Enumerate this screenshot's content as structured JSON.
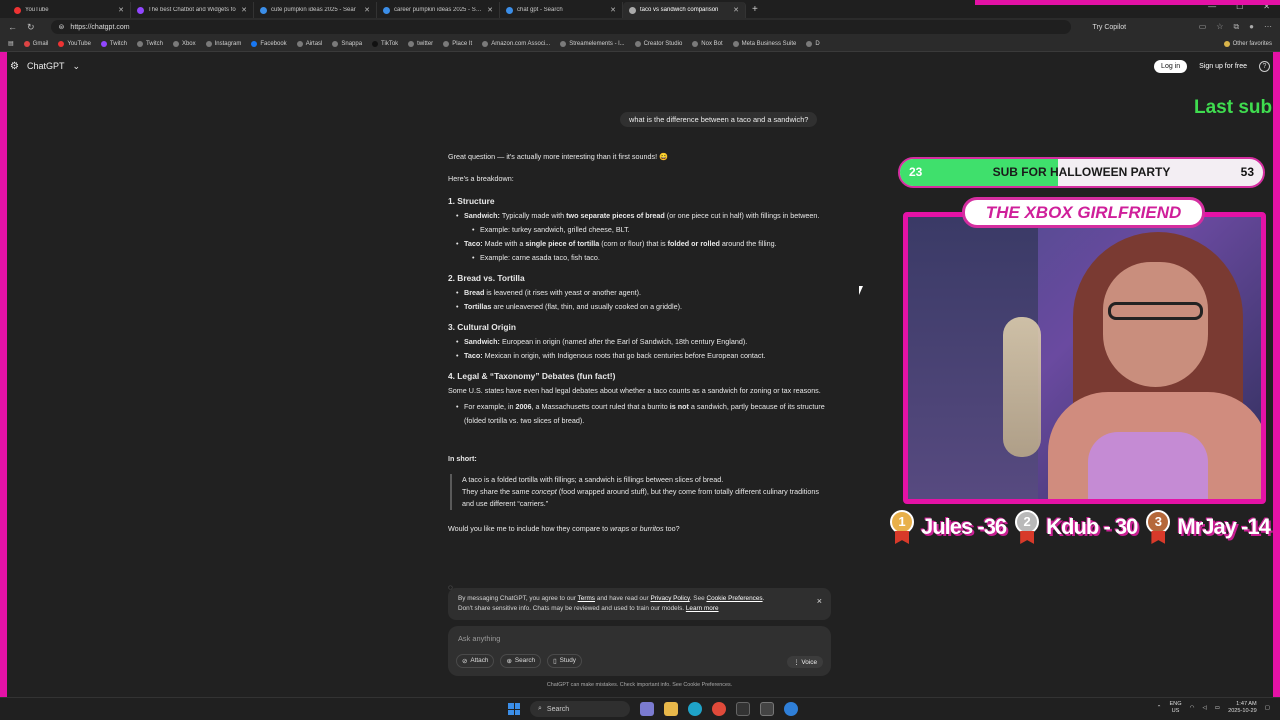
{
  "browser": {
    "tabs": [
      {
        "label": "YouTube",
        "active": false
      },
      {
        "label": "The best Chatbot and Widgets fo",
        "active": false
      },
      {
        "label": "cute pumpkin ideas 2025 - Sear",
        "active": false
      },
      {
        "label": "career pumpkin ideas 2025 - Sear",
        "active": false
      },
      {
        "label": "chat gpt - Search",
        "active": false
      },
      {
        "label": "taco vs sandwich comparison",
        "active": true
      }
    ],
    "new_tab": "+",
    "url": "https://chatgpt.com",
    "copilot": "Try Copilot",
    "bookmarks": [
      "Gmail",
      "YouTube",
      "Twitch",
      "Twitch",
      "Xbox",
      "Instagram",
      "Facebook",
      "Airtasl",
      "Snappa",
      "TikTok",
      "twitter",
      "Place It",
      "Amazon.com Associ...",
      "Streamelements - l...",
      "Creator Studio",
      "Nox Bot",
      "Meta Business Suite",
      "D"
    ],
    "other_favorites": "Other favorites"
  },
  "chatgpt": {
    "brand": "ChatGPT",
    "login": "Log in",
    "signup": "Sign up for free",
    "help": "?",
    "user_message": "what is the difference between a taco and a sandwich?",
    "answer": {
      "intro": "Great question — it's actually more interesting than it first sounds! 😄",
      "breakdown": "Here's a breakdown:",
      "s1_title": "1. Structure",
      "s1_sandwich_label": "Sandwich:",
      "s1_sandwich_a": " Typically made with ",
      "s1_sandwich_b": "two separate pieces of bread",
      "s1_sandwich_c": " (or one piece cut in half) with fillings in between.",
      "s1_sandwich_ex": "Example: turkey sandwich, grilled cheese, BLT.",
      "s1_taco_label": "Taco:",
      "s1_taco_a": " Made with a ",
      "s1_taco_b": "single piece of tortilla",
      "s1_taco_c": " (corn or flour) that is ",
      "s1_taco_d": "folded or rolled",
      "s1_taco_e": " around the filling.",
      "s1_taco_ex": "Example: carne asada taco, fish taco.",
      "s2_title": "2. Bread vs. Tortilla",
      "s2_bread_label": "Bread",
      "s2_bread_text": " is leavened (it rises with yeast or another agent).",
      "s2_tort_label": "Tortillas",
      "s2_tort_text": " are unleavened (flat, thin, and usually cooked on a griddle).",
      "s3_title": "3. Cultural Origin",
      "s3_sandwich_label": "Sandwich:",
      "s3_sandwich_text": " European in origin (named after the Earl of Sandwich, 18th century England).",
      "s3_taco_label": "Taco:",
      "s3_taco_text": " Mexican in origin, with Indigenous roots that go back centuries before European contact.",
      "s4_title": "4. Legal & “Taxonomy” Debates (fun fact!)",
      "s4_text": "Some U.S. states have even had legal debates about whether a taco counts as a sandwich for zoning or tax reasons.",
      "s4_ex_a": "For example, in ",
      "s4_ex_year": "2006",
      "s4_ex_b": ", a Massachusetts court ruled that a burrito ",
      "s4_ex_not": "is not",
      "s4_ex_c": " a sandwich, partly because of its structure (folded tortilla vs. two slices of bread).",
      "inshort": "In short:",
      "quote_1": "A taco is a folded tortilla with fillings; a sandwich is fillings between slices of bread.",
      "quote_2a": "They share the same ",
      "quote_2b": "concept",
      "quote_2c": " (food wrapped around stuff), but they come from totally different culinary traditions and use different “carriers.”",
      "followup_a": "Would you like me to include how they compare to ",
      "followup_b": "wraps",
      "followup_c": " or ",
      "followup_d": "burritos",
      "followup_e": " too?"
    },
    "cookie": {
      "t1": "By messaging ChatGPT, you agree to our ",
      "terms": "Terms",
      "t2": " and have read our ",
      "privacy": "Privacy Policy",
      "t3": ". See ",
      "prefs": "Cookie Preferences",
      "t4": ".",
      "t5": "Don't share sensitive info. Chats may be reviewed and used to train our models. ",
      "learn": "Learn more",
      "close": "×"
    },
    "composer": {
      "placeholder": "Ask anything",
      "attach": "Attach",
      "search": "Search",
      "study": "Study",
      "voice": "Voice"
    },
    "disclaimer": "ChatGPT can make mistakes. Check important info. See Cookie Preferences."
  },
  "overlay": {
    "last_sub": "Last sub",
    "goal_current": "23",
    "goal_text": "SUB FOR HALLOWEEN PARTY",
    "goal_target": "53",
    "goal_progress": 0.434,
    "title": "THE XBOX GIRLFRIEND",
    "leaders": [
      {
        "rank": "1",
        "text": "Jules -36"
      },
      {
        "rank": "2",
        "text": "Kdub - 30"
      },
      {
        "rank": "3",
        "text": "MrJay -14"
      }
    ],
    "colors": {
      "pink": "#e412a6",
      "green": "#3fe06c"
    }
  },
  "taskbar": {
    "search": "Search",
    "lang": "ENG",
    "lang2": "US",
    "time": "1:47 AM",
    "date": "2025-10-29"
  }
}
